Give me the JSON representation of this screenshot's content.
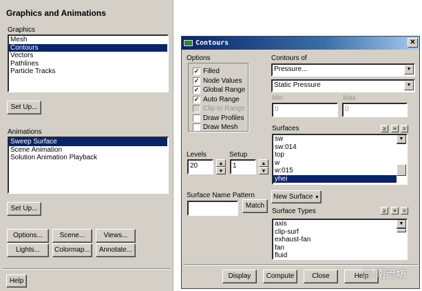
{
  "graphics_panel": {
    "title": "Graphics and Animations",
    "graphics_label": "Graphics",
    "graphics_items": [
      "Mesh",
      "Contours",
      "Vectors",
      "Pathlines",
      "Particle Tracks"
    ],
    "setup1": "Set Up...",
    "animations_label": "Animations",
    "animation_items": [
      "Sweep Surface",
      "Scene Animation",
      "Solution Animation Playback"
    ],
    "setup2": "Set Up...",
    "buttons": [
      "Options...",
      "Scene...",
      "Views...",
      "Lights...",
      "Colormap...",
      "Annotate..."
    ],
    "help": "Help"
  },
  "contours": {
    "title": "Contours",
    "close_icon": "close-icon",
    "options_label": "Options",
    "options": [
      {
        "label": "Filled",
        "checked": true,
        "enabled": true
      },
      {
        "label": "Node Values",
        "checked": true,
        "enabled": true
      },
      {
        "label": "Global Range",
        "checked": true,
        "enabled": true
      },
      {
        "label": "Auto Range",
        "checked": true,
        "enabled": true
      },
      {
        "label": "Clip to Range",
        "checked": false,
        "enabled": false
      },
      {
        "label": "Draw Profiles",
        "checked": false,
        "enabled": true
      },
      {
        "label": "Draw Mesh",
        "checked": false,
        "enabled": true
      }
    ],
    "contours_of_label": "Contours of",
    "contours_of": "Pressure...",
    "contours_sub": "Static Pressure",
    "min_label": "Min",
    "min": "0",
    "max_label": "Max",
    "max": "0",
    "levels_label": "Levels",
    "levels": "20",
    "setup_label": "Setup",
    "setup": "1",
    "surfaces_label": "Surfaces",
    "surfaces": [
      "sw",
      "sw:014",
      "top",
      "w",
      "w:015",
      "yhei"
    ],
    "pattern_label": "Surface Name Pattern",
    "pattern": "",
    "match": "Match",
    "new_surface": "New Surface",
    "surface_types_label": "Surface Types",
    "surface_types": [
      "axis",
      "clip-surf",
      "exhaust-fan",
      "fan",
      "fluid"
    ],
    "buttons": [
      "Display",
      "Compute",
      "Close",
      "Help"
    ]
  },
  "watermark": "南流坊"
}
